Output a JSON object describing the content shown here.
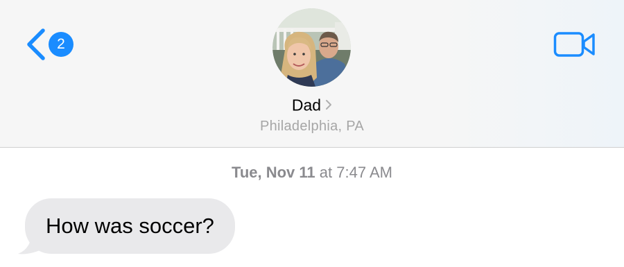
{
  "header": {
    "back_badge_count": "2",
    "contact_name": "Dad",
    "contact_location": "Philadelphia, PA"
  },
  "conversation": {
    "timestamp_day": "Tue, Nov 11",
    "timestamp_at": " at ",
    "timestamp_time": "7:47 AM",
    "messages": [
      {
        "direction": "incoming",
        "text": "How was soccer?"
      }
    ]
  },
  "icons": {
    "back": "chevron-left-icon",
    "video": "video-camera-icon",
    "name_disclosure": "chevron-right-icon"
  },
  "colors": {
    "accent": "#1a8cff",
    "incoming_bubble": "#e9e9eb",
    "secondary_text": "#8a8a8e",
    "location_text": "#a6a6a6"
  }
}
